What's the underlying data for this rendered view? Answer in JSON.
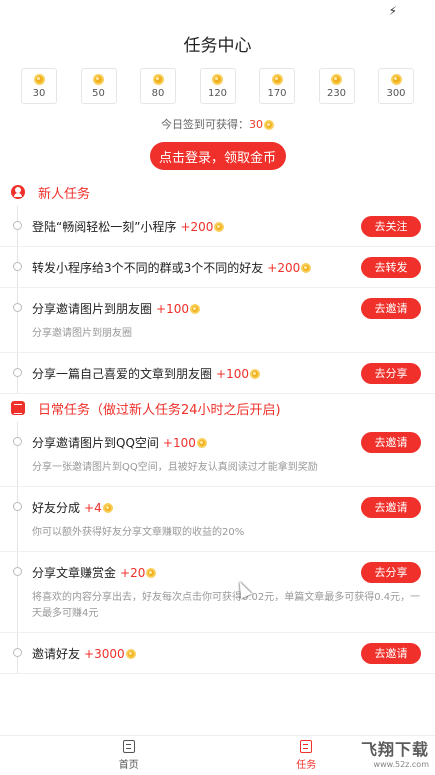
{
  "status_bar": {
    "icon": "charging-bolt-icon"
  },
  "page_title": "任务中心",
  "signin": {
    "days": [
      "30",
      "50",
      "80",
      "120",
      "170",
      "230",
      "300"
    ],
    "today_prefix": "今日签到可获得：",
    "today_amount": "30"
  },
  "login_button": "点击登录，领取金币",
  "sections": [
    {
      "title": "新人任务",
      "icon": "person-icon",
      "tasks": [
        {
          "title": "登陆“畅阅轻松一刻”小程序",
          "reward": "+200",
          "button": "去关注",
          "desc": ""
        },
        {
          "title": "转发小程序给3个不同的群或3个不同的好友",
          "reward": "+200",
          "button": "去转发",
          "desc": ""
        },
        {
          "title": "分享邀请图片到朋友圈",
          "reward": "+100",
          "button": "去邀请",
          "desc": "分享邀请图片到朋友圈"
        },
        {
          "title": "分享一篇自己喜爱的文章到朋友圈",
          "reward": "+100",
          "button": "去分享",
          "desc": ""
        }
      ]
    },
    {
      "title": "日常任务（做过新人任务24小时之后开启)",
      "icon": "document-icon",
      "tasks": [
        {
          "title": "分享邀请图片到QQ空间",
          "reward": "+100",
          "button": "去邀请",
          "desc": "分享一张邀请图片到QQ空间，且被好友认真阅读过才能拿到奖励"
        },
        {
          "title": "好友分成",
          "reward": "+4",
          "button": "去邀请",
          "desc": "你可以额外获得好友分享文章赚取的收益的20%"
        },
        {
          "title": "分享文章赚赏金",
          "reward": "+20",
          "button": "去分享",
          "desc": "将喜欢的内容分享出去，好友每次点击你可获得0.02元，单篇文章最多可获得0.4元，一天最多可赚4元"
        },
        {
          "title": "邀请好友",
          "reward": "+3000",
          "button": "去邀请",
          "desc": ""
        }
      ]
    }
  ],
  "tabbar": {
    "items": [
      {
        "label": "首页",
        "icon": "home-icon",
        "active": false
      },
      {
        "label": "任务",
        "icon": "task-list-icon",
        "active": true
      }
    ]
  },
  "watermark": {
    "big": "飞翔下载",
    "small": "www.52z.com"
  },
  "colors": {
    "accent": "#f0302a",
    "coin": "#f2b01e"
  }
}
